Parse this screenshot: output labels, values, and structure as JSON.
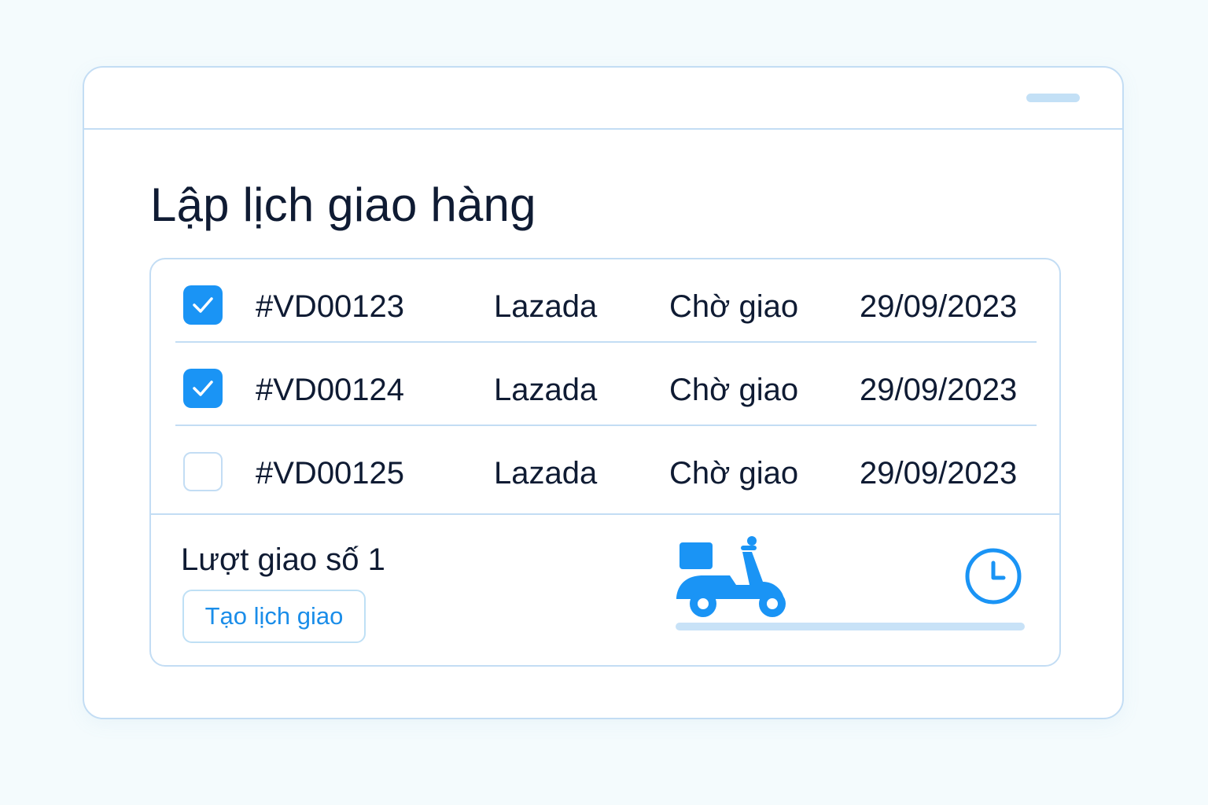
{
  "page": {
    "title": "Lập lịch giao hàng"
  },
  "orders": [
    {
      "checked": true,
      "id": "#VD00123",
      "shop": "Lazada",
      "status": "Chờ giao",
      "date": "29/09/2023"
    },
    {
      "checked": true,
      "id": "#VD00124",
      "shop": "Lazada",
      "status": "Chờ giao",
      "date": "29/09/2023"
    },
    {
      "checked": false,
      "id": "#VD00125",
      "shop": "Lazada",
      "status": "Chờ giao",
      "date": "29/09/2023"
    }
  ],
  "footer": {
    "trip_label": "Lượt giao số 1",
    "create_button_label": "Tạo lịch giao",
    "icons": [
      "delivery-scooter-icon",
      "clock-icon"
    ],
    "progress": 0
  },
  "colors": {
    "accent": "#1a94f5",
    "border": "#c3ddf4",
    "text": "#0f1b33",
    "background": "#f4fbfd"
  }
}
